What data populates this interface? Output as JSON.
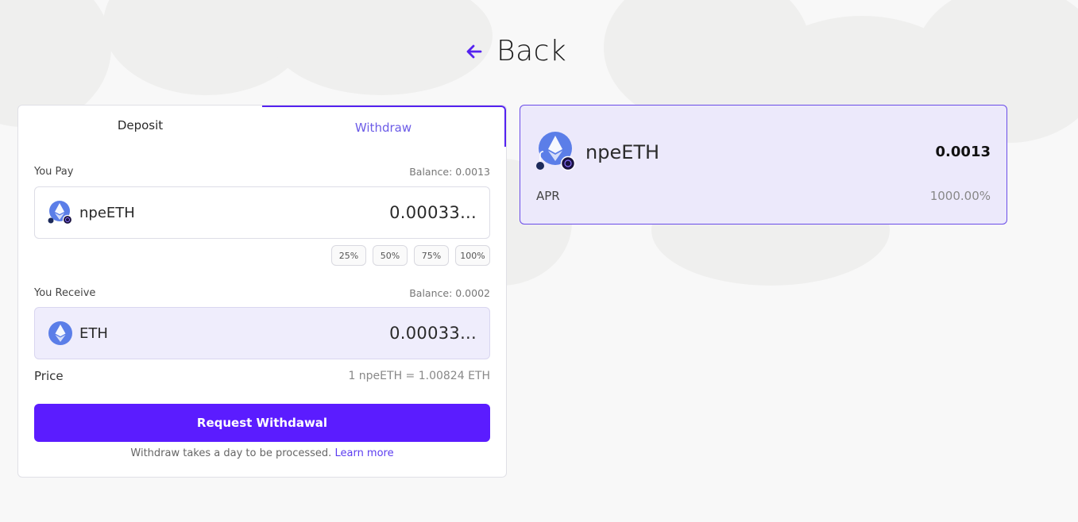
{
  "nav": {
    "back_label": "Back"
  },
  "tabs": [
    {
      "label": "Deposit",
      "active": false
    },
    {
      "label": "Withdraw",
      "active": true
    }
  ],
  "pay": {
    "label": "You Pay",
    "balance": "Balance: 0.0013",
    "token": "npeETH",
    "amount": "0.00033..."
  },
  "percent_buttons": [
    "25%",
    "50%",
    "75%",
    "100%"
  ],
  "receive": {
    "label": "You Receive",
    "balance": "Balance: 0.0002",
    "token": "ETH",
    "amount": "0.00033..."
  },
  "price": {
    "label": "Price",
    "value": "1 npeETH = 1.00824 ETH"
  },
  "action": {
    "button_label": "Request Withdawal",
    "note": "Withdraw takes a day to be processed.",
    "learn_more": "Learn more"
  },
  "position": {
    "token": "npeETH",
    "balance": "0.0013",
    "apr_label": "APR",
    "apr_value": "1000.00%"
  },
  "colors": {
    "accent": "#5b1cff",
    "tab_active_border": "#5422f0",
    "receive_bg": "#efedfc",
    "info_card_bg": "#ece9fb"
  },
  "icons": {
    "back": "arrow-left-icon",
    "npeeth": "npeeth-token-icon",
    "eth": "eth-token-icon"
  }
}
